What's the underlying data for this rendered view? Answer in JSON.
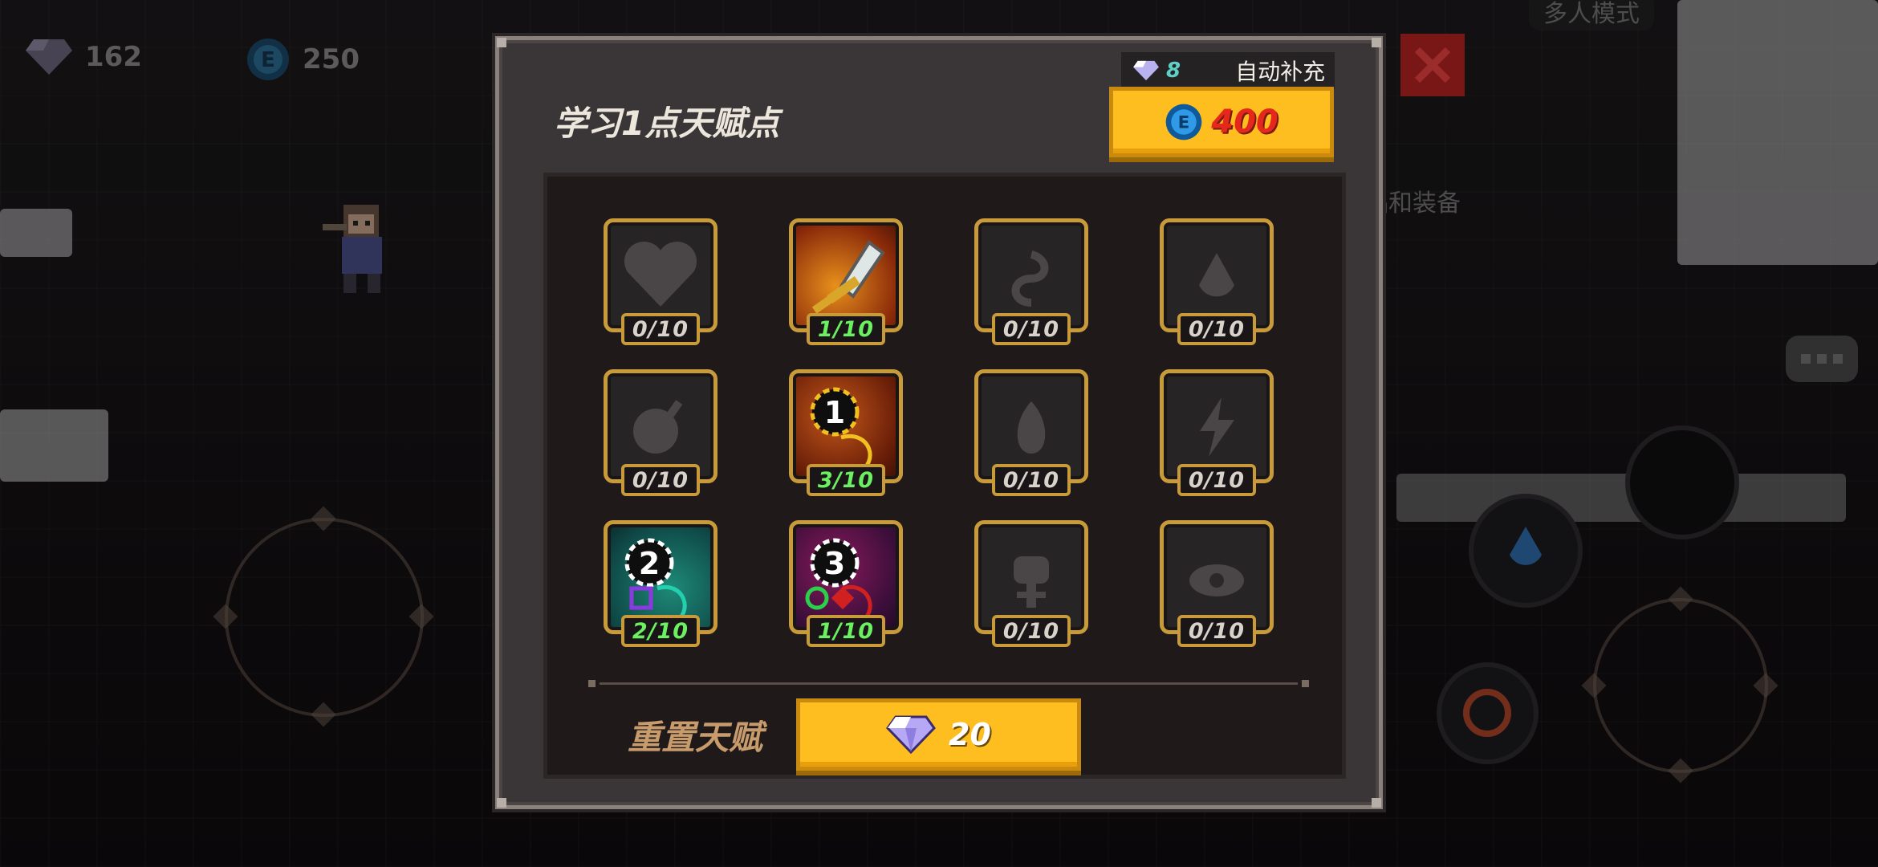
{
  "hud": {
    "gems": "162",
    "coins": "250",
    "mode_label": "多人模式",
    "equip_label": "品和装备"
  },
  "dialog": {
    "title": "学习1点天赋点",
    "auto_refill": {
      "gem_count": "8",
      "label": "自动补充"
    },
    "learn_cost": "400",
    "reset_label": "重置天赋",
    "reset_cost": "20"
  },
  "talents": [
    {
      "icon": "heart-icon",
      "level": "0/10",
      "unlocked": false
    },
    {
      "icon": "sword-icon",
      "level": "1/10",
      "unlocked": true
    },
    {
      "icon": "swirl-icon",
      "level": "0/10",
      "unlocked": false
    },
    {
      "icon": "drop-icon",
      "level": "0/10",
      "unlocked": false
    },
    {
      "icon": "bomb-icon",
      "level": "0/10",
      "unlocked": false
    },
    {
      "icon": "badge-1-icon",
      "level": "3/10",
      "unlocked": true
    },
    {
      "icon": "flame-icon",
      "level": "0/10",
      "unlocked": false
    },
    {
      "icon": "lightning-icon",
      "level": "0/10",
      "unlocked": false
    },
    {
      "icon": "badge-2-icon",
      "level": "2/10",
      "unlocked": true
    },
    {
      "icon": "badge-3-icon",
      "level": "1/10",
      "unlocked": true
    },
    {
      "icon": "hand-icon",
      "level": "0/10",
      "unlocked": false
    },
    {
      "icon": "eye-icon",
      "level": "0/10",
      "unlocked": false
    }
  ],
  "colors": {
    "button_gold": "#ffbe20",
    "level_active": "#6af061",
    "cost_red": "#e6281c",
    "frame_gold": "#c89a3a"
  }
}
